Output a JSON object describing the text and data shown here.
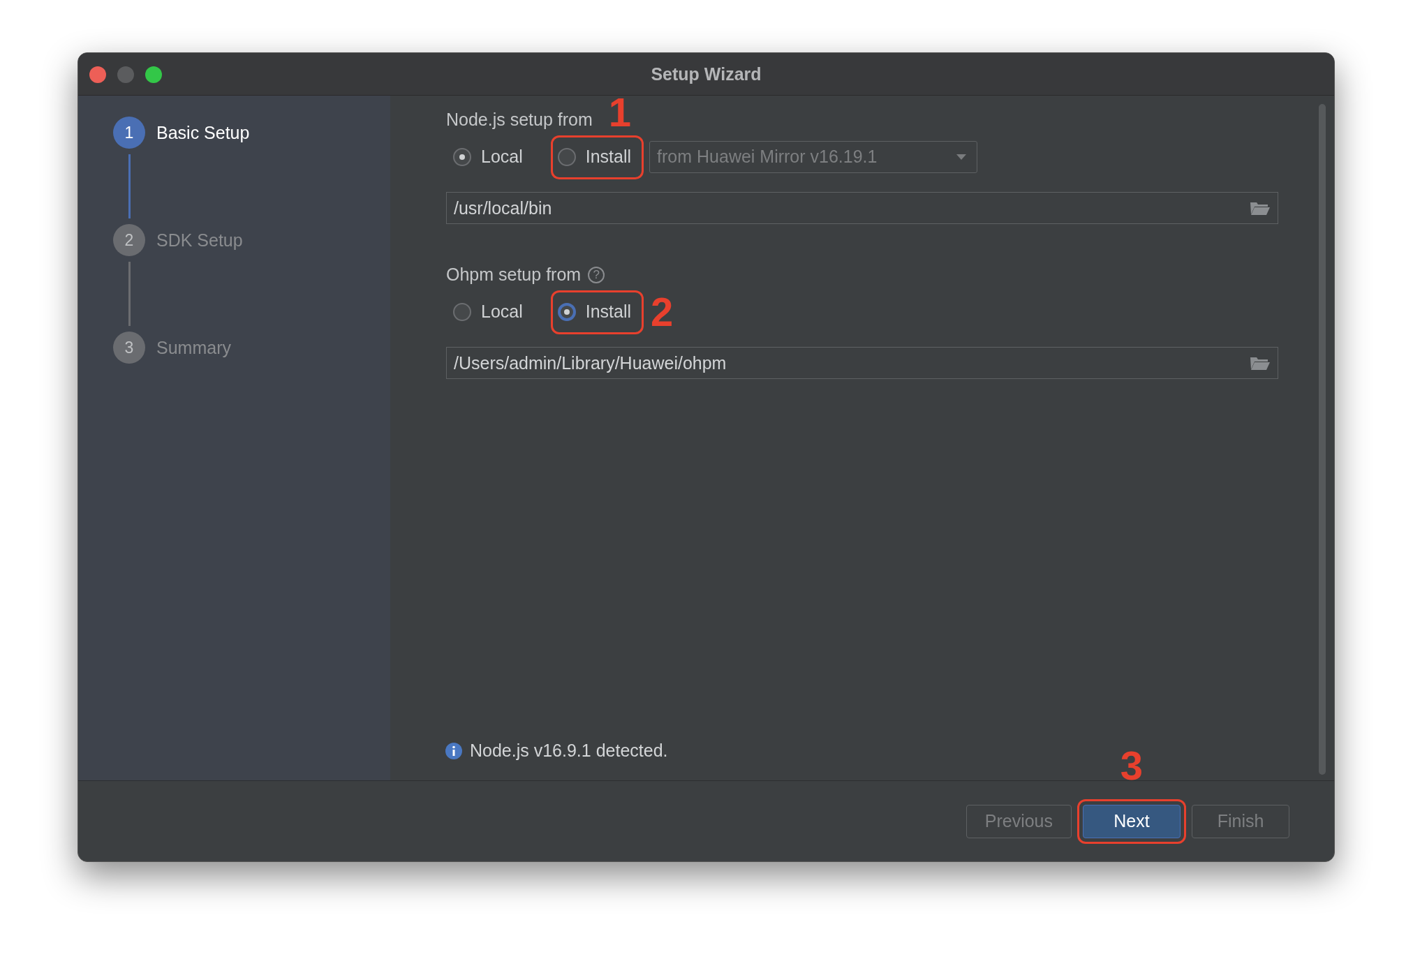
{
  "window": {
    "title": "Setup Wizard"
  },
  "steps": [
    {
      "number": "1",
      "label": "Basic Setup",
      "selected": true
    },
    {
      "number": "2",
      "label": "SDK Setup",
      "selected": false
    },
    {
      "number": "3",
      "label": "Summary",
      "selected": false
    }
  ],
  "sections": [
    {
      "label": "Node.js setup from",
      "options": [
        {
          "label": "Local",
          "selected": true,
          "highlighted": false
        },
        {
          "label": "Install",
          "selected": false,
          "highlighted": true,
          "annotation": "1",
          "annotation_above": true
        }
      ],
      "dropdown": {
        "value": "from Huawei Mirror v16.19.1",
        "disabled": true
      },
      "path": "/usr/local/bin"
    },
    {
      "label": "Ohpm setup from",
      "help": "?",
      "options": [
        {
          "label": "Local",
          "selected": false,
          "highlighted": false
        },
        {
          "label": "Install",
          "selected": true,
          "highlighted": true,
          "annotation": "2",
          "annotation_above": false
        }
      ],
      "path": "/Users/admin/Library/Huawei/ohpm"
    }
  ],
  "info": "Node.js v16.9.1 detected.",
  "buttons": [
    {
      "label": "Previous",
      "primary": false,
      "disabled": true,
      "highlighted": false
    },
    {
      "label": "Next",
      "primary": true,
      "disabled": false,
      "highlighted": true,
      "annotation": "3",
      "annotation_above": true
    },
    {
      "label": "Finish",
      "primary": false,
      "disabled": true,
      "highlighted": false
    }
  ]
}
